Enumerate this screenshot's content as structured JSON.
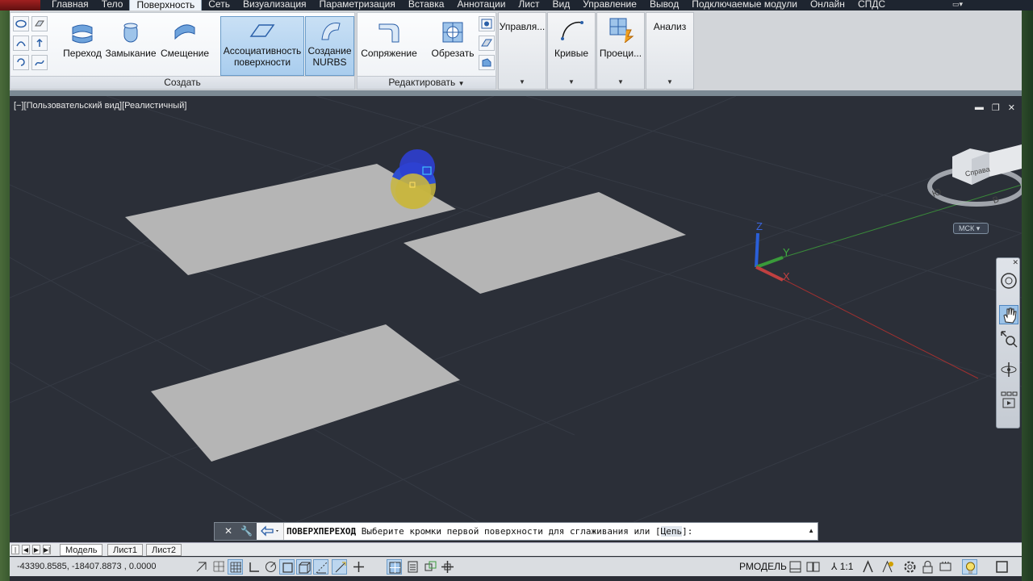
{
  "menu": {
    "tabs": [
      "Главная",
      "Тело",
      "Поверхность",
      "Сеть",
      "Визуализация",
      "Параметризация",
      "Вставка",
      "Аннотации",
      "Лист",
      "Вид",
      "Управление",
      "Вывод",
      "Подключаемые модули",
      "Онлайн",
      "СПДС"
    ],
    "active": "Поверхность"
  },
  "ribbon": {
    "create": {
      "title": "Создать",
      "transition": "Переход",
      "closure": "Замыкание",
      "offset": "Смещение",
      "associativity_l1": "Ассоциативность",
      "associativity_l2": "поверхности",
      "nurbs_l1": "Создание",
      "nurbs_l2": "NURBS"
    },
    "edit": {
      "title": "Редактировать",
      "fillet": "Сопряжение",
      "trim": "Обрезать"
    },
    "control": {
      "label": "Управля..."
    },
    "curves": {
      "label": "Кривые"
    },
    "projection": {
      "label": "Проеци..."
    },
    "analysis": {
      "label": "Анализ"
    }
  },
  "viewport": {
    "label": "[−][Пользовательский вид][Реалистичный]",
    "ucs_label": "МСК",
    "viewcube_face": "Справа",
    "compass_w": "Ю",
    "compass_e": "В",
    "axis_x": "X",
    "axis_y": "Y",
    "axis_z": "Z"
  },
  "command": {
    "name": "ПОВЕРХПЕРЕХОД",
    "prompt": " Выберите кромки первой поверхности для сглаживания или [",
    "option": "Цепь",
    "suffix": "]:"
  },
  "layout_tabs": [
    "Модель",
    "Лист1",
    "Лист2"
  ],
  "status": {
    "coords": "-43390.8585, -18407.8873 , 0.0000",
    "model_mode": "РМОДЕЛЬ",
    "scale": "1:1"
  },
  "colors": {
    "viewport_bg": "#2b2f38",
    "surface": "#b5b5b5",
    "accent_blue": "#3d72c0"
  }
}
